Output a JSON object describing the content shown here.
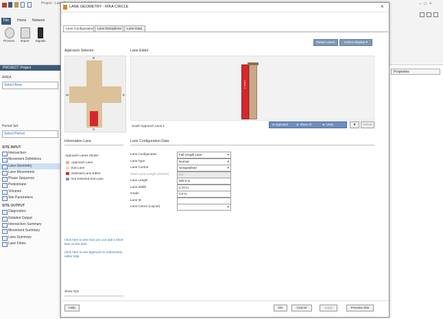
{
  "app": {
    "window_title": "Project - Lane Geometry - InfraWorks",
    "ribbon_tabs": [
      "File",
      "Home",
      "Network"
    ],
    "ribbon_buttons": [
      {
        "label": "Process",
        "icon": "process-icon"
      },
      {
        "label": "Import",
        "icon": "import-icon"
      },
      {
        "label": "Signals",
        "icon": "signal-icon"
      }
    ],
    "window_controls": [
      "–",
      "□",
      "×"
    ]
  },
  "left_panel": {
    "title": "PROJECT: Project",
    "area_label": "AREA",
    "area_value": "Select Area",
    "time_label": "Period Set",
    "time_value": "Select Period",
    "sections": [
      {
        "heading": "SITE INPUT",
        "items": [
          {
            "label": "Intersection",
            "selected": false
          },
          {
            "label": "Movement Definitions",
            "selected": false
          },
          {
            "label": "Lane Geometry",
            "selected": true
          },
          {
            "label": "Lane Movements",
            "selected": false
          },
          {
            "label": "Phase Sequence",
            "selected": false
          },
          {
            "label": "Pedestrians",
            "selected": false
          },
          {
            "label": "Volumes",
            "selected": false
          },
          {
            "label": "Site Parameters",
            "selected": false
          }
        ]
      },
      {
        "heading": "SITE OUTPUT",
        "items": [
          {
            "label": "Diagnostics",
            "selected": false
          },
          {
            "label": "Detailed Output",
            "selected": false
          },
          {
            "label": "Intersection Summary",
            "selected": false
          },
          {
            "label": "Movement Summary",
            "selected": false
          },
          {
            "label": "Lane Summary",
            "selected": false
          },
          {
            "label": "Lane Flows",
            "selected": false
          }
        ]
      }
    ]
  },
  "right_panel": {
    "tab_label": "Properties"
  },
  "dialog": {
    "title": "LANE GEOMETRY - RIKA CIRCLE",
    "close": "×",
    "tabs": [
      "Lane Configuration",
      "Lane Disciplines",
      "Lane Data"
    ],
    "active_tab": 0,
    "top_buttons": [
      "Reset Lanes",
      "Select Display ▾"
    ],
    "approach_selector": {
      "heading": "Approach Selector",
      "labels": [
        "N",
        "E",
        "S",
        "W"
      ],
      "selected_label": "S"
    },
    "lane_editor": {
      "heading": "Lane Editor",
      "lane_text": "Lane 1",
      "footer_label": "South Approach Lane 1",
      "footer_buttons": [
        "◄ Approach",
        "► Show All",
        "► Undo"
      ],
      "small_buttons": [
        "▼",
        "Delete"
      ]
    },
    "info": {
      "heading": "Information Lane",
      "legend_title": "Approach Lanes Shown",
      "legend": [
        {
          "label": "Approach Lane",
          "color": "#d9b98a"
        },
        {
          "label": "Exit Lane",
          "color": "#e9d9b6"
        },
        {
          "label": "Selected Lane Editor",
          "color": "#d8262e"
        },
        {
          "label": "Not Selected Exit Lane",
          "color": "#7f98b8"
        }
      ],
      "link1": "Click here to see how you can add a short lane or bus lane",
      "link2": "Click here to see approach to intersection editor help",
      "help_label": "Show Tips"
    },
    "lane_config": {
      "heading": "Lane Configuration Data",
      "rows": [
        {
          "label": "Lane Configuration",
          "value": "Full Length Lane",
          "dropdown": true,
          "disabled": false
        },
        {
          "label": "Lane Type",
          "value": "Normal",
          "dropdown": true,
          "disabled": false
        },
        {
          "label": "Lane Control",
          "value": "Unsignalised",
          "dropdown": true,
          "disabled": false
        },
        {
          "label": "Short Lane Length (metres)",
          "value": "0.0",
          "dropdown": false,
          "disabled": true
        },
        {
          "label": "Lane Length",
          "value": "500.0 m",
          "dropdown": false,
          "disabled": false
        },
        {
          "label": "Lane Width",
          "value": "3.70 m",
          "dropdown": false,
          "disabled": false
        },
        {
          "label": "Grade",
          "value": "0.0 %",
          "dropdown": false,
          "disabled": false
        },
        {
          "label": "Lane ID",
          "value": "",
          "dropdown": false,
          "disabled": false
        },
        {
          "label": "Lane Colour (Layout)",
          "value": "",
          "dropdown": true,
          "disabled": false
        }
      ]
    },
    "footer_left": "Help",
    "footer_buttons": [
      "OK",
      "Cancel",
      "Apply",
      "Preview Site"
    ]
  },
  "colors": {
    "lane_selected": "#d8262e",
    "lane_exit": "#c8a886",
    "road": "#dcc29a",
    "editor_bg": "#f2f2f2",
    "accent_blue": "#6d8ebf"
  }
}
